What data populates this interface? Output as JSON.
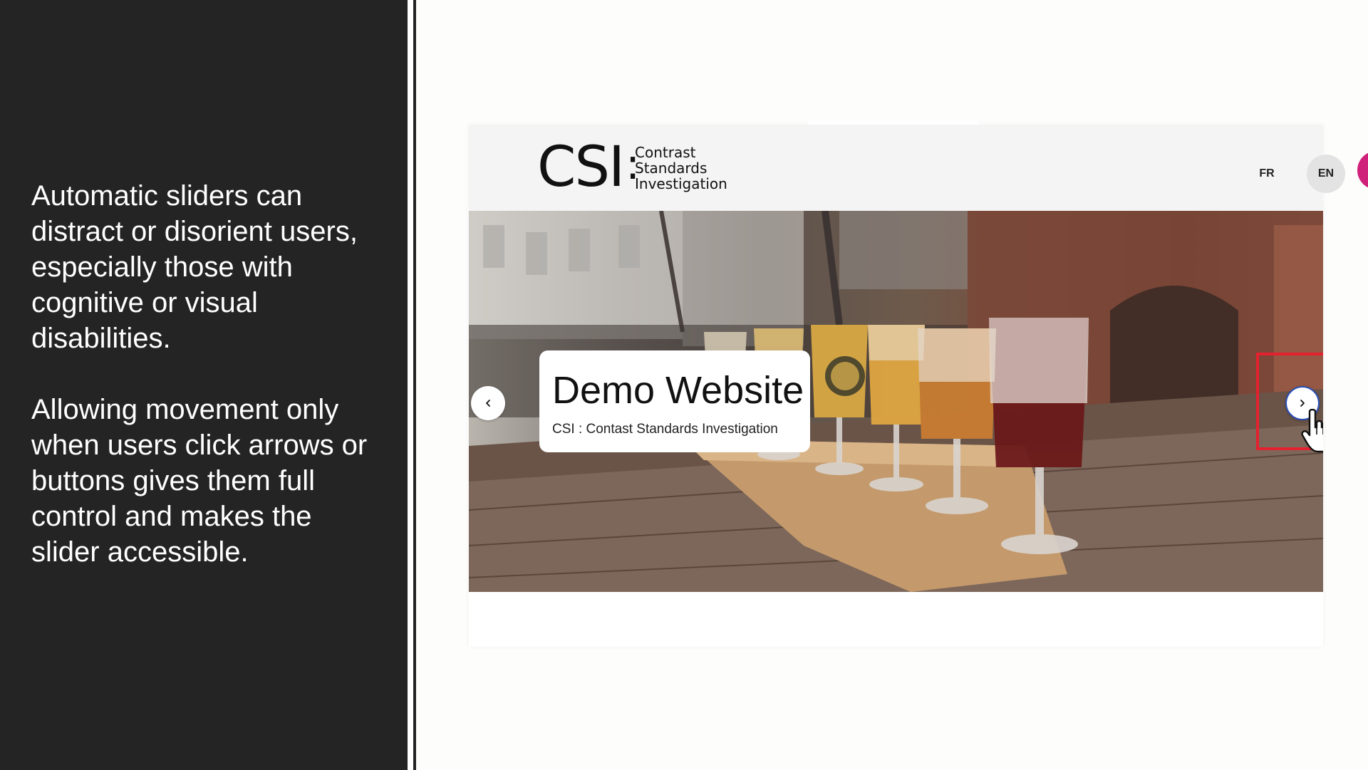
{
  "left_panel": {
    "paragraph_1": "Automatic sliders can distract or disorient users, especially those with cognitive or visual disabilities.",
    "paragraph_2": "Allowing movement only when users click arrows or buttons gives them full control and makes the slider accessible."
  },
  "demo_site": {
    "logo": {
      "mark": "CSI",
      "line_1": "Contrast",
      "line_2": "Standards",
      "line_3": "Investigation"
    },
    "languages": [
      {
        "code": "FR",
        "active": false
      },
      {
        "code": "EN",
        "active": true
      }
    ],
    "search_icon": "search-icon",
    "colors": {
      "accent": "#d0217a",
      "highlight": "#e3212f",
      "focus_ring": "#2b4fb5",
      "panel_bg": "#242424"
    },
    "slider": {
      "caption_title": "Demo Website",
      "caption_subtitle": "CSI : Contast Standards Investigation",
      "prev_icon": "chevron-left-icon",
      "next_icon": "chevron-right-icon",
      "cursor_icon": "hand-pointer-icon"
    }
  }
}
